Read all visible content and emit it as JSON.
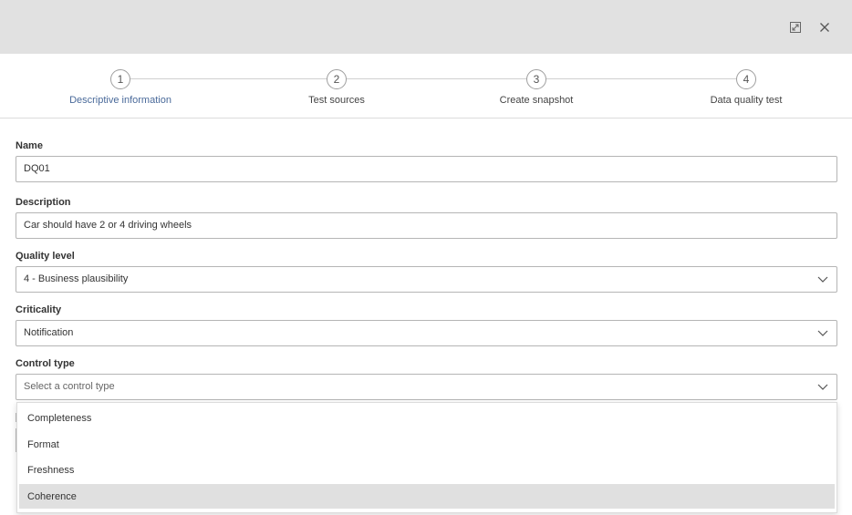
{
  "header": {
    "expand_icon": "expand-icon",
    "close_icon": "close-icon"
  },
  "steps": [
    {
      "number": "1",
      "label": "Descriptive information",
      "active": true
    },
    {
      "number": "2",
      "label": "Test sources",
      "active": false
    },
    {
      "number": "3",
      "label": "Create snapshot",
      "active": false
    },
    {
      "number": "4",
      "label": "Data quality test",
      "active": false
    }
  ],
  "form": {
    "name": {
      "label": "Name",
      "value": "DQ01"
    },
    "description": {
      "label": "Description",
      "value": "Car should have 2 or 4 driving wheels"
    },
    "quality_level": {
      "label": "Quality level",
      "value": "4 - Business plausibility"
    },
    "criticality": {
      "label": "Criticality",
      "value": "Notification"
    },
    "control_type": {
      "label": "Control type",
      "placeholder": "Select a control type"
    }
  },
  "dropdown": {
    "options": [
      "Completeness",
      "Format",
      "Freshness",
      "Coherence"
    ],
    "highlighted": "Coherence"
  },
  "colors": {
    "header_bg": "#e1e1e1",
    "active_step": "#4a6a9a",
    "highlight": "#e0e0e0"
  }
}
